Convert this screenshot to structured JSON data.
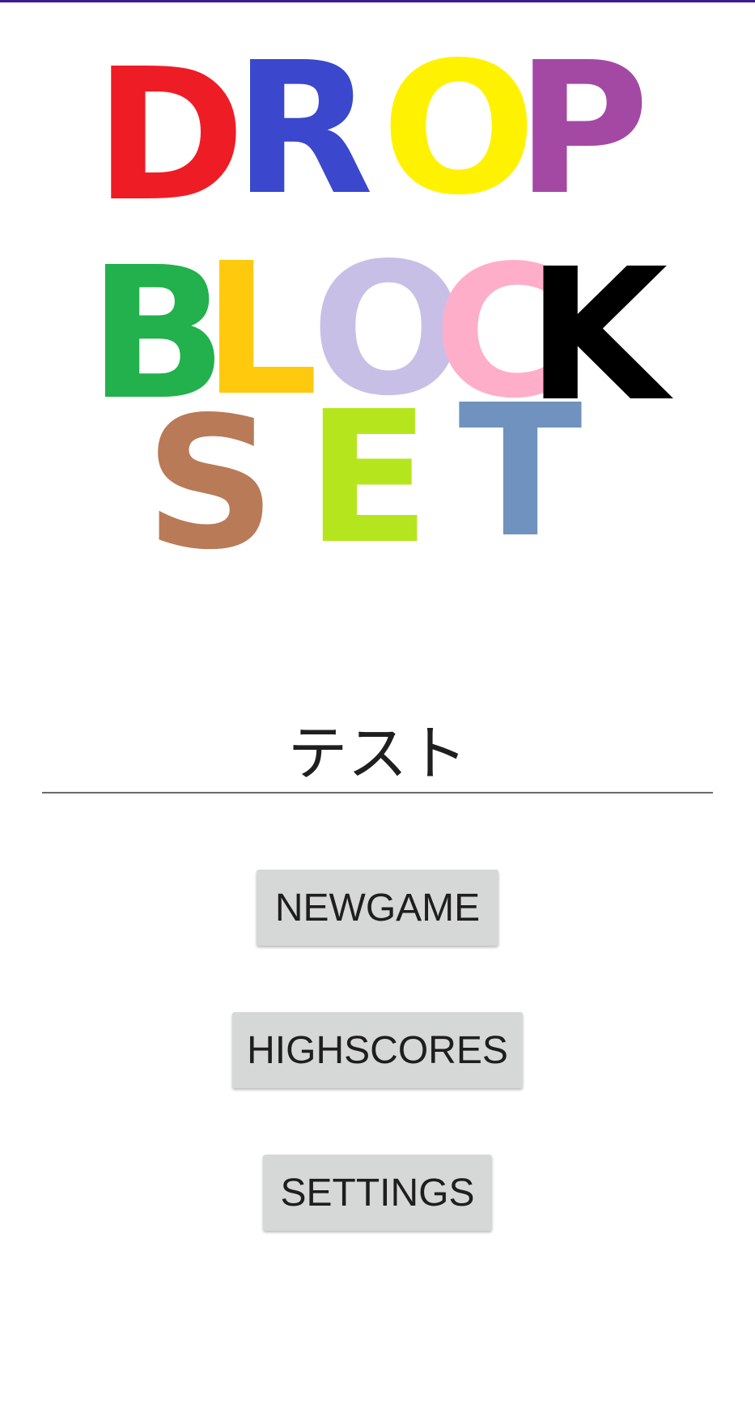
{
  "logo": {
    "rows": [
      {
        "letters": [
          {
            "char": "D",
            "color": "#ee1c25"
          },
          {
            "char": "R",
            "color": "#3b47cc"
          },
          {
            "char": "O",
            "color": "#fff200"
          },
          {
            "char": "P",
            "color": "#a349a4"
          }
        ]
      },
      {
        "letters": [
          {
            "char": "B",
            "color": "#22b14c"
          },
          {
            "char": "L",
            "color": "#ffc90e"
          },
          {
            "char": "O",
            "color": "#c8bfe7"
          },
          {
            "char": "C",
            "color": "#ffaec9"
          },
          {
            "char": "K",
            "color": "#000000"
          }
        ]
      },
      {
        "letters": [
          {
            "char": "S",
            "color": "#b97a57"
          },
          {
            "char": "E",
            "color": "#b5e61d"
          },
          {
            "char": "T",
            "color": "#7092be"
          }
        ]
      }
    ]
  },
  "name_input": {
    "value": "テスト"
  },
  "menu": {
    "newgame_label": "NEWGAME",
    "highscores_label": "HIGHSCORES",
    "settings_label": "SETTINGS"
  },
  "colors": {
    "top_bar": "#3f1a8f",
    "button_bg": "#d6d7d7"
  }
}
